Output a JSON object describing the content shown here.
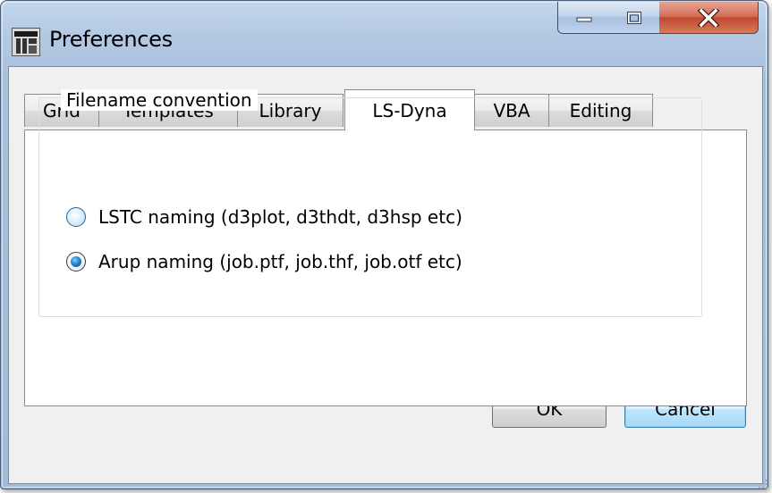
{
  "window": {
    "title": "Preferences",
    "app_icon": "opd-app-icon",
    "caption_buttons": [
      "minimize-icon",
      "maximize-icon",
      "close-icon"
    ]
  },
  "tabs": [
    {
      "label": "Grid",
      "active": false
    },
    {
      "label": "Templates",
      "active": false
    },
    {
      "label": "Library",
      "active": false
    },
    {
      "label": "LS-Dyna",
      "active": true
    },
    {
      "label": "VBA",
      "active": false
    },
    {
      "label": "Editing",
      "active": false
    }
  ],
  "group": {
    "legend": "Filename convention",
    "options": [
      {
        "label": "LSTC naming (d3plot, d3thdt, d3hsp etc)",
        "checked": false
      },
      {
        "label": "Arup naming (job.ptf, job.thf, job.otf etc)",
        "checked": true
      }
    ]
  },
  "buttons": {
    "ok": "OK",
    "cancel": "Cancel"
  },
  "colors": {
    "frame": "#a9c0dd",
    "close_button": "#c04a2f",
    "client_bg": "#f0f0f0",
    "accent_blue": "#3c7fb1"
  }
}
